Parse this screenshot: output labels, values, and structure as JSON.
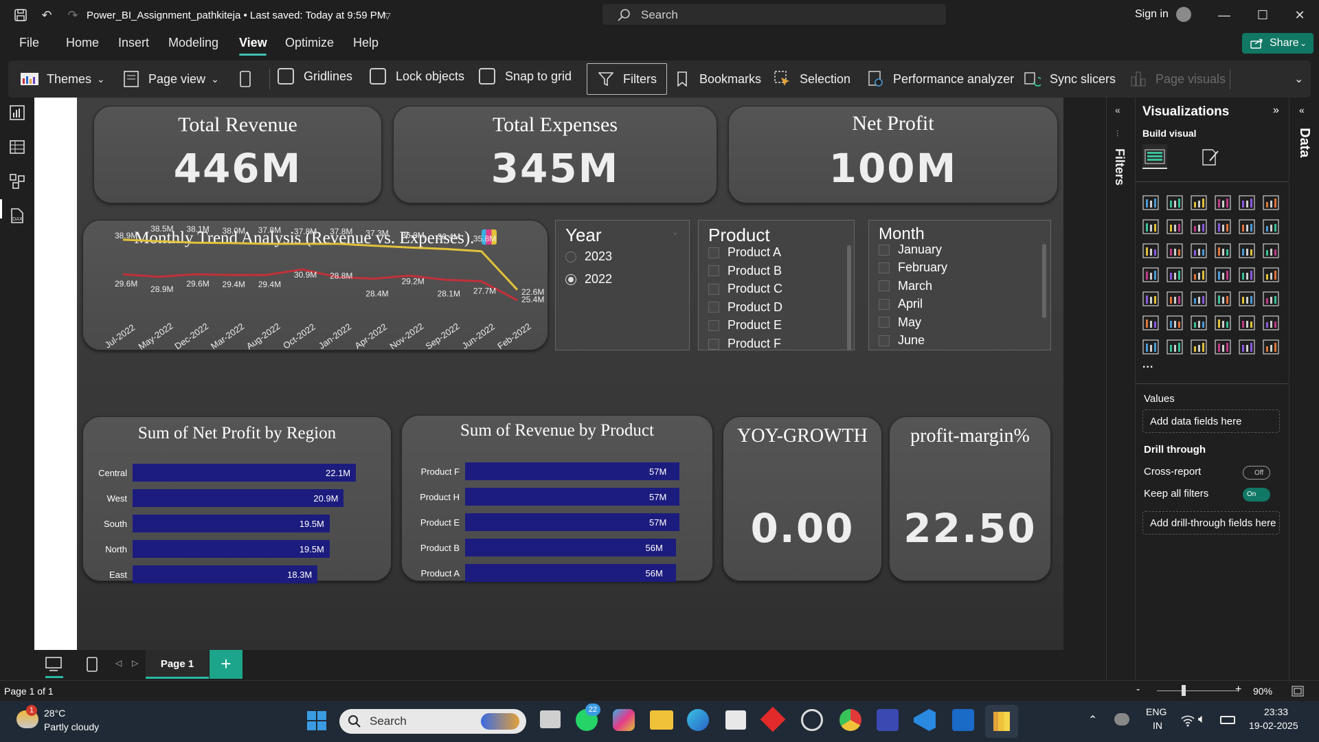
{
  "titlebar": {
    "doc_title": "Power_BI_Assignment_pathkiteja • Last saved: Today at 9:59 PM",
    "search_placeholder": "Search",
    "signin": "Sign in"
  },
  "menu": {
    "items": [
      "File",
      "Home",
      "Insert",
      "Modeling",
      "View",
      "Optimize",
      "Help"
    ],
    "active": "View",
    "share": "Share"
  },
  "ribbon": {
    "themes": "Themes",
    "page_view": "Page view",
    "gridlines": "Gridlines",
    "lock_objects": "Lock objects",
    "snap_to_grid": "Snap to grid",
    "filters": "Filters",
    "bookmarks": "Bookmarks",
    "selection": "Selection",
    "performance_analyzer": "Performance analyzer",
    "sync_slicers": "Sync slicers",
    "page_visuals": "Page visuals"
  },
  "kpis": [
    {
      "title": "Total Revenue",
      "value": "446M"
    },
    {
      "title": "Total Expenses",
      "value": "345M"
    },
    {
      "title": "Net Profit",
      "value": "100M"
    }
  ],
  "trend": {
    "title": "Monthly Trend Analysis (Revenue vs. Expenses).",
    "icon": "bar-chart-emoji"
  },
  "chart_data": [
    {
      "type": "line",
      "title": "Monthly Trend Analysis (Revenue vs. Expenses).",
      "categories": [
        "Jul-2022",
        "May-2022",
        "Dec-2022",
        "Mar-2022",
        "Aug-2022",
        "Oct-2022",
        "Jan-2022",
        "Apr-2022",
        "Nov-2022",
        "Sep-2022",
        "Jun-2022",
        "Feb-2022"
      ],
      "series": [
        {
          "color": "#e2c23a",
          "values": [
            38.9,
            38.5,
            38.1,
            38.0,
            37.8,
            37.8,
            37.8,
            37.3,
            36.8,
            36.4,
            35.8,
            25.4
          ],
          "labels": [
            "38.9M",
            "38.5M",
            "38.1M",
            "38.0M",
            "37.8M",
            "37.8M",
            "37.8M",
            "37.3M",
            "36.8M",
            "36.4M",
            "35.8M",
            "25.4M"
          ]
        },
        {
          "color": "#c2303a",
          "values": [
            29.6,
            28.9,
            29.6,
            29.4,
            29.4,
            30.9,
            28.8,
            28.4,
            29.2,
            28.1,
            27.7,
            22.6
          ],
          "labels": [
            "29.6M",
            "28.9M",
            "29.6M",
            "29.4M",
            "29.4M",
            "30.9M",
            "28.8M",
            "28.4M",
            "29.2M",
            "28.1M",
            "27.7M",
            "22.6M"
          ]
        }
      ]
    },
    {
      "type": "bar",
      "title": "Sum of Net Profit by Region",
      "categories": [
        "Central",
        "West",
        "South",
        "North",
        "East"
      ],
      "values": [
        22.1,
        20.9,
        19.5,
        19.5,
        18.3
      ],
      "labels": [
        "22.1M",
        "20.9M",
        "19.5M",
        "19.5M",
        "18.3M"
      ]
    },
    {
      "type": "bar",
      "title": "Sum of Revenue by Product",
      "categories": [
        "Product F",
        "Product H",
        "Product E",
        "Product B",
        "Product A"
      ],
      "values": [
        57,
        57,
        57,
        56,
        56
      ],
      "labels": [
        "57M",
        "57M",
        "57M",
        "56M",
        "56M"
      ]
    }
  ],
  "slicers": {
    "year": {
      "title": "Year",
      "items": [
        "2023",
        "2022"
      ],
      "selected": "2022"
    },
    "product": {
      "title": "Product",
      "items": [
        "Product A",
        "Product B",
        "Product C",
        "Product D",
        "Product E",
        "Product F"
      ]
    },
    "month": {
      "title": "Month",
      "items": [
        "January",
        "February",
        "March",
        "April",
        "May",
        "June"
      ]
    }
  },
  "cards": [
    {
      "title": "YOY-GROWTH",
      "value": "0.00"
    },
    {
      "title": "profit-margin%",
      "value": "22.50"
    }
  ],
  "panes": {
    "filters": "Filters",
    "visualizations": "Visualizations",
    "build_visual": "Build visual",
    "values_label": "Values",
    "values_well": "Add data fields here",
    "drill_through": "Drill through",
    "cross_report": "Cross-report",
    "cross_report_state": "Off",
    "keep_all_filters": "Keep all filters",
    "keep_all_filters_state": "On",
    "drill_well": "Add drill-through fields here",
    "data": "Data",
    "more": "..."
  },
  "pages": {
    "tab": "Page 1",
    "add": "+"
  },
  "status": {
    "page": "Page 1 of 1",
    "zoom": "90%",
    "zoom_minus": "-",
    "zoom_plus": "+"
  },
  "taskbar": {
    "weather_temp": "28°C",
    "weather_desc": "Partly cloudy",
    "weather_badge": "1",
    "search": "Search",
    "whatsapp_badge": "22",
    "lang": "ENG",
    "region": "IN",
    "time": "23:33",
    "date": "19-02-2025"
  },
  "colors": {
    "accent": "#117865",
    "bar": "#1c1c7e",
    "revenue_line": "#e2c23a",
    "expense_line": "#c2303a"
  }
}
